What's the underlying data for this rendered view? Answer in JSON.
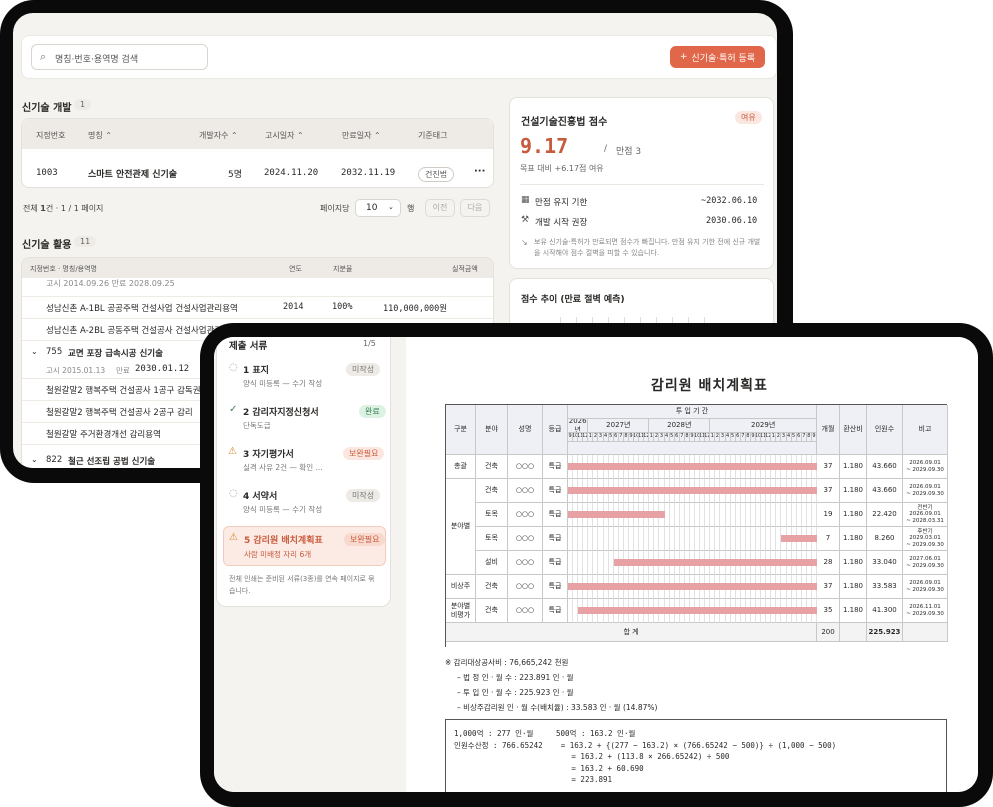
{
  "s1": {
    "search_placeholder": "명칭·번호·용역명 검색",
    "register_button": "신기술·특허 등록",
    "dev": {
      "title": "신기술 개발",
      "count": "1",
      "columns": [
        "지정번호",
        "명칭",
        "개발자수",
        "고시일자",
        "만료일자",
        "기준태그"
      ],
      "row": {
        "no": "1003",
        "name": "스마트 안전관제 신기술",
        "devs": "5명",
        "notice": "2024.11.20",
        "expire": "2032.11.19",
        "tag": "건진법",
        "more": "···"
      }
    },
    "pager": {
      "total_prefix": "전체 ",
      "total_count": "1",
      "total_suffix": "건 · 1 / 1 페이지",
      "per_page_label": "페이지당",
      "per_page_value": "10",
      "per_page_unit": "행",
      "prev": "이전",
      "next": "다음"
    },
    "use": {
      "title": "신기술 활용",
      "count": "11",
      "columns": [
        "지정번호 · 명칭/용역명",
        "연도",
        "지분율",
        "실적금액"
      ],
      "partial_line": "고시 2014.09.26  만료 2028.09.25",
      "rows": [
        {
          "name": "성남신촌 A-1BL 공공주택 건설사업 건설사업관리용역",
          "year": "2014",
          "share": "100%",
          "amount": "110,000,000원"
        },
        {
          "name": "성남신촌 A-2BL 공동주택 건설공사 건설사업관리용역",
          "year": "",
          "share": "",
          "amount": ""
        }
      ],
      "group2": {
        "no": "755",
        "name": "교면 포장 급속시공 신기술",
        "notice_label": "고시 2015.01.13",
        "expire_label": "만료",
        "expire": "2030.01.12"
      },
      "rows2": [
        "철원갈말2 행복주택 건설공사 1공구 감독권",
        "철원갈말2 행복주택 건설공사 2공구 감리",
        "철원갈말 주거환경개선 감리용역"
      ],
      "group3": {
        "no": "822",
        "name": "철근 선조립 공법 신기술"
      }
    },
    "score": {
      "title": "건설기술진흥법 점수",
      "badge": "여유",
      "value": "9.17",
      "slash": "/",
      "max": "만점 3",
      "diff": "목표 대비 +6.17점 여유",
      "rows": [
        {
          "label": "만점 유지 기한",
          "value": "~2032.06.10"
        },
        {
          "label": "개발 시작 권장",
          "value": "2030.06.10"
        }
      ],
      "note": "보유 신기술·특허가 만료되면 점수가 빠집니다. 만점 유지 기한 전에 신규 개발을 시작해야 점수 절벽을 피할 수 있습니다."
    },
    "trend_title": "점수 추이 (만료 절벽 예측)"
  },
  "s2": {
    "docs": {
      "title": "제출 서류",
      "progress": "1/5",
      "items": [
        {
          "label": "1 표지",
          "sub": "양식 미등록 — 수기 작성",
          "badge": "미작성",
          "icon": "circle-icon"
        },
        {
          "label": "2 감리자지정신청서",
          "sub": "단독도급",
          "badge": "완료",
          "icon": "check-icon"
        },
        {
          "label": "3 자기평가서",
          "sub": "실격 사유 2건 — 확인 ...",
          "badge": "보완필요",
          "icon": "warning-icon"
        },
        {
          "label": "4 서약서",
          "sub": "양식 미등록 — 수기 작성",
          "badge": "미작성",
          "icon": "circle-icon"
        },
        {
          "label": "5 감리원 배치계획표",
          "sub": "사람 미배정 자리 6개",
          "badge": "보완필요",
          "icon": "warning-icon"
        }
      ],
      "footer": "전체 인쇄는 준비된 서류(3종)를 연속 페이지로 묶습니다."
    },
    "plan": {
      "title": "감리원  배치계획표",
      "headers": {
        "kind": "구분",
        "field": "분야",
        "name": "성명",
        "grade": "등급",
        "period": "투 입 기 간",
        "months": "개월",
        "factor": "환산비",
        "persons": "인원수",
        "remark": "비고"
      },
      "years": [
        "2026년",
        "2027년",
        "2028년",
        "2029년"
      ],
      "month_cells": [
        "9",
        "10",
        "11",
        "12",
        "1",
        "2",
        "3",
        "4",
        "5",
        "6",
        "7",
        "8",
        "9",
        "10",
        "11",
        "12",
        "1",
        "2",
        "3",
        "4",
        "5",
        "6",
        "7",
        "8",
        "9",
        "10",
        "11",
        "12",
        "1",
        "2",
        "3",
        "4",
        "5",
        "6",
        "7",
        "8",
        "9",
        "10",
        "11",
        "12",
        "1",
        "2",
        "3",
        "4",
        "5",
        "6",
        "7",
        "8",
        "9"
      ],
      "rows": [
        {
          "kind": "총괄",
          "field": "건축",
          "name": "○○○",
          "grade": "특급",
          "months": "37",
          "factor": "1.180",
          "persons": "43.660",
          "remark": "2026.09.01\n~ 2029.09.30"
        },
        {
          "kind": "",
          "field": "건축",
          "name": "○○○",
          "grade": "특급",
          "months": "37",
          "factor": "1.180",
          "persons": "43.660",
          "remark": "2026.09.01\n~ 2029.09.30"
        },
        {
          "kind": "",
          "field": "토목",
          "name": "○○○",
          "grade": "특급",
          "months": "19",
          "factor": "1.180",
          "persons": "22.420",
          "remark": "전반기\n2026.09.01\n~ 2028.03.31"
        },
        {
          "kind": "",
          "field": "토목",
          "name": "○○○",
          "grade": "특급",
          "months": "7",
          "factor": "1.180",
          "persons": "8.260",
          "remark": "후반기\n2029.03.01\n~ 2029.09.30"
        },
        {
          "kind": "",
          "field": "설비",
          "name": "○○○",
          "grade": "특급",
          "months": "28",
          "factor": "1.180",
          "persons": "33.040",
          "remark": "2027.06.01\n~ 2029.09.30"
        },
        {
          "kind": "비상주",
          "field": "건축",
          "name": "○○○",
          "grade": "특급",
          "months": "37",
          "factor": "1.180",
          "persons": "33.583",
          "remark": "2026.09.01\n~ 2029.09.30"
        },
        {
          "kind": "분야별\n비평가",
          "field": "건축",
          "name": "○○○",
          "grade": "특급",
          "months": "35",
          "factor": "1.180",
          "persons": "41.300",
          "remark": "2026.11.01\n~ 2029.09.30"
        }
      ],
      "group_label": "분야별",
      "total": {
        "label": "합 계",
        "months": "200",
        "persons": "225.923"
      },
      "bar_fraction": [
        [
          0,
          1
        ],
        [
          0,
          1
        ],
        [
          0,
          0.388
        ],
        [
          0.857,
          1
        ],
        [
          0.184,
          1
        ],
        [
          0,
          1
        ],
        [
          0.041,
          1
        ]
      ],
      "notes": [
        "※ 감리대상공사비 : 76,665,242 천원",
        "– 법 정 인 · 월 수 : 223.891 인 · 월",
        "– 투 입 인 · 월 수 : 225.923 인 · 월",
        "– 비상주감리원 인 · 월 수(배치율) : 33.583 인 · 월 (14.87%)"
      ],
      "calc": [
        "1,000억 : 277 인·월     500억 : 163.2 인·월",
        "인원수산정 : 766.65242    = 163.2 + {(277 − 163.2) × (766.65242 − 500)} ÷ (1,000 − 500)",
        "                          = 163.2 + (113.8 × 266.65242) ÷ 500",
        "                          = 163.2 + 60.690",
        "                          = 223.891"
      ]
    }
  },
  "colors": {
    "accent": "#e0674a",
    "pink_bar": "#e8a2a6",
    "score": "#c85a3d"
  }
}
